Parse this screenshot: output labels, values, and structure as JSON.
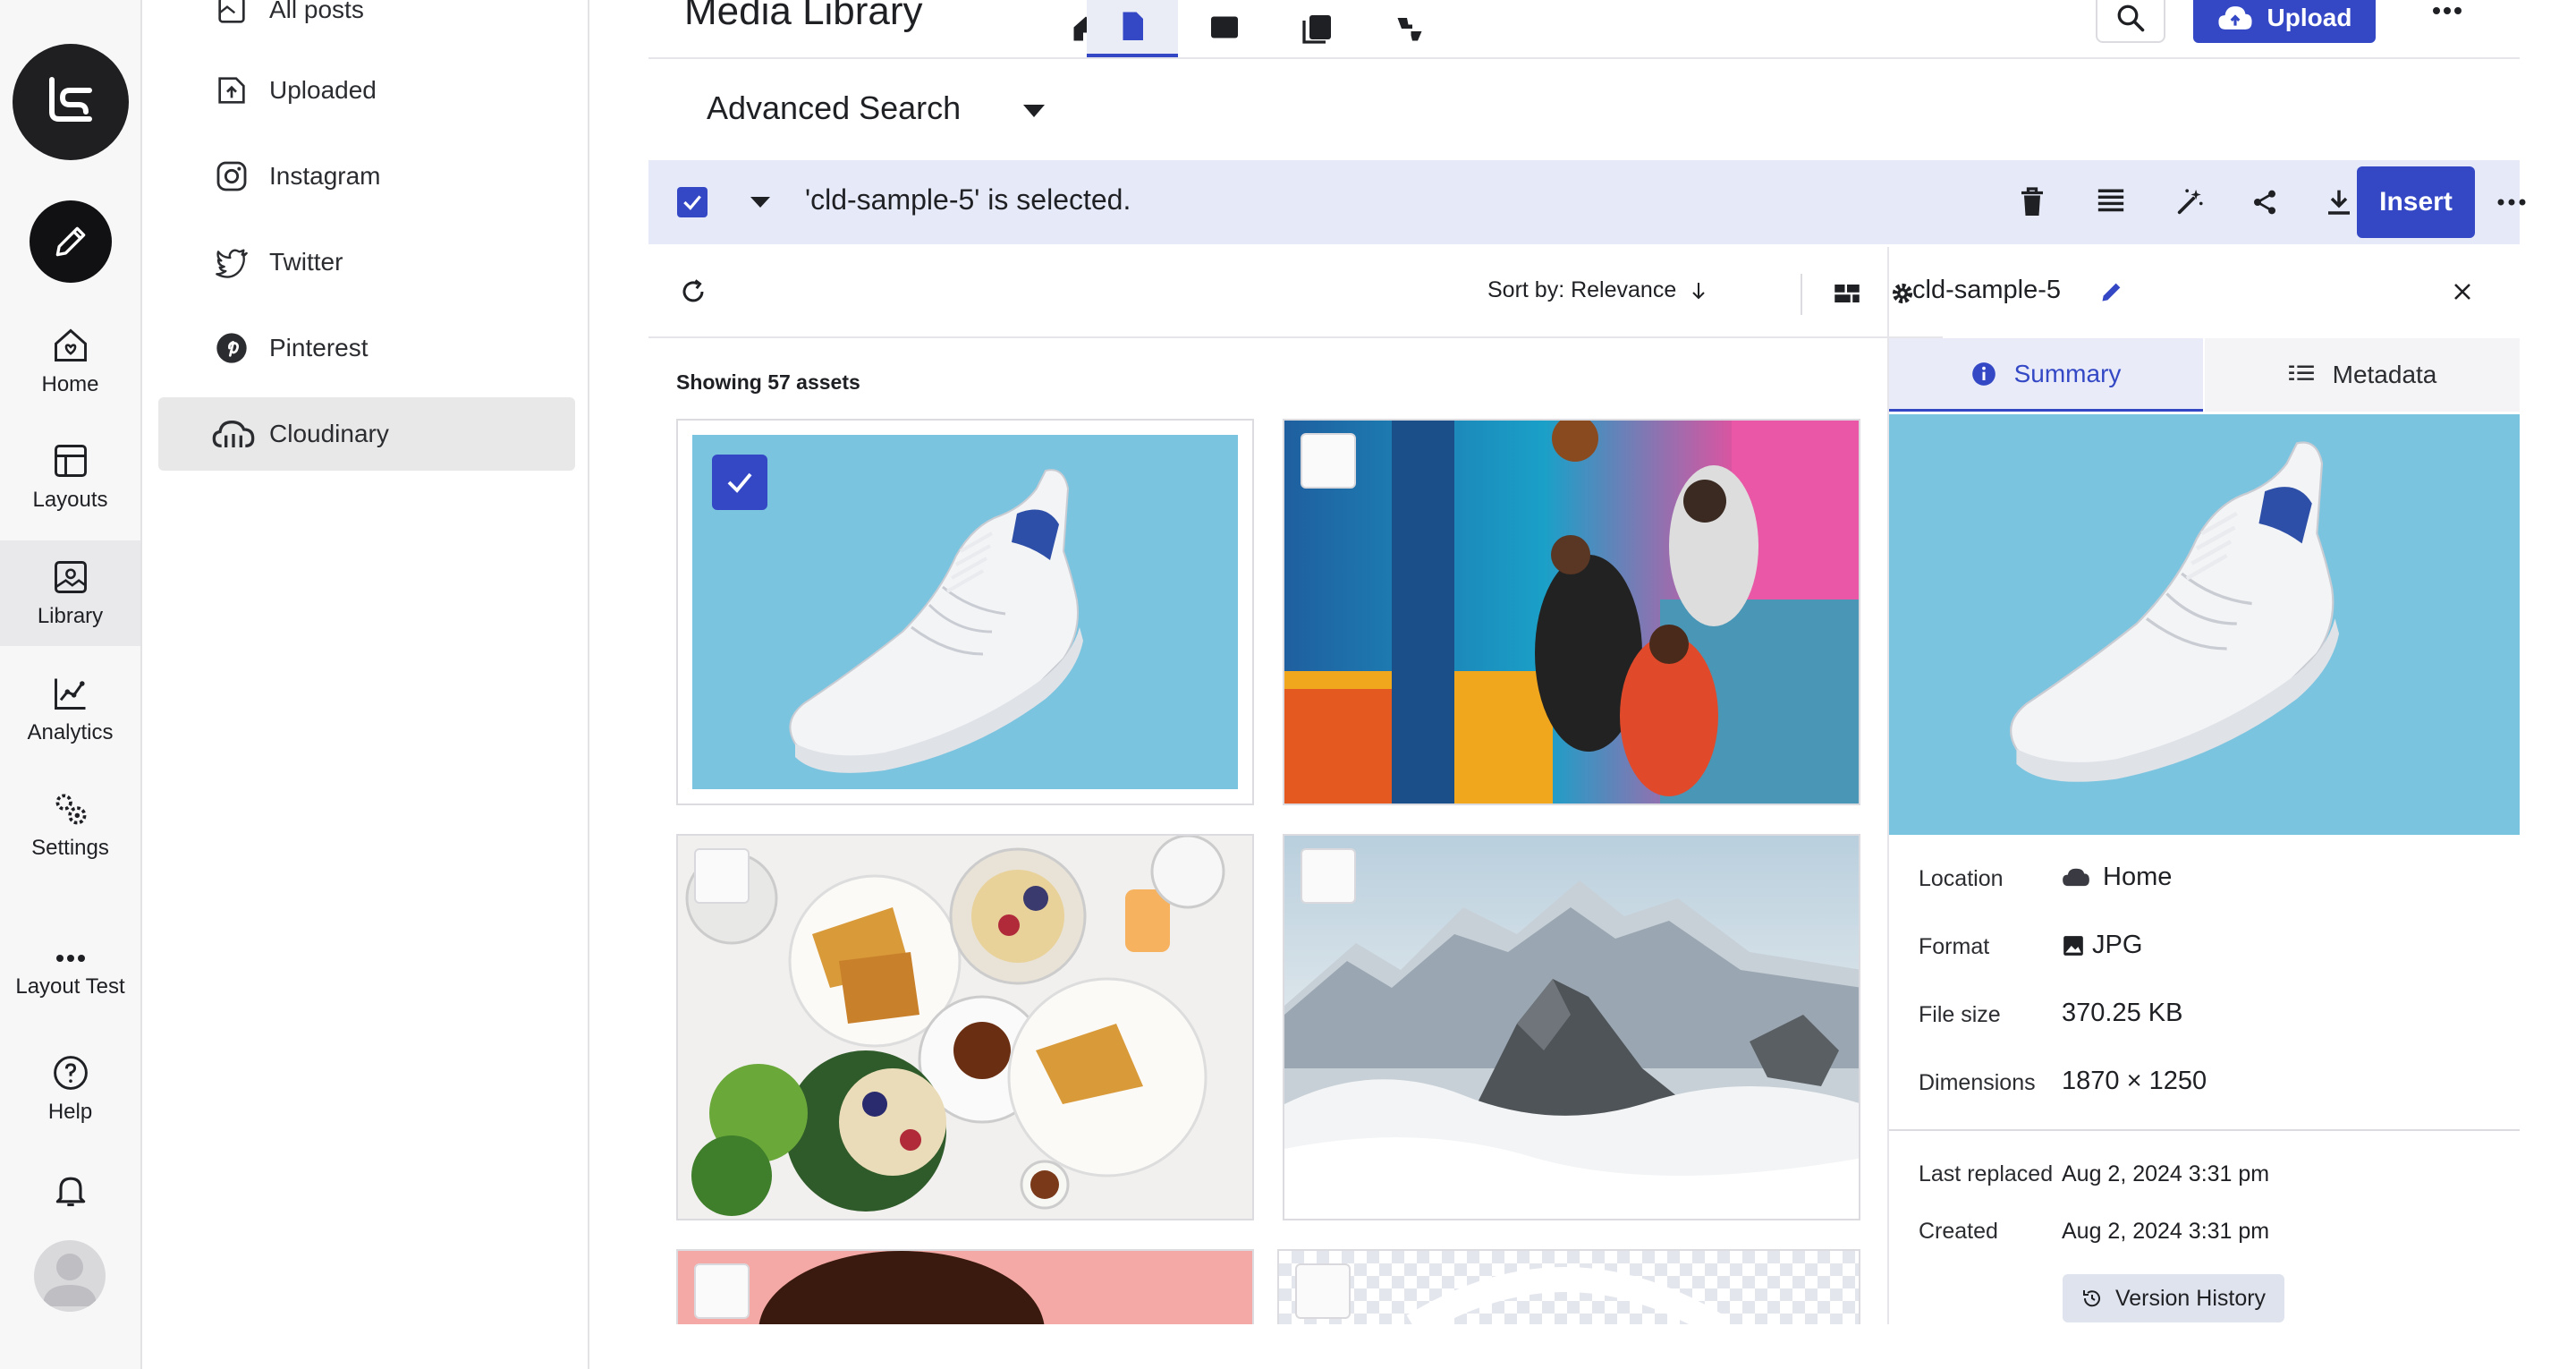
{
  "rail": {
    "items": [
      {
        "label": "Home",
        "icon": "home-heart-icon"
      },
      {
        "label": "Layouts",
        "icon": "layouts-icon"
      },
      {
        "label": "Library",
        "icon": "library-icon"
      },
      {
        "label": "Analytics",
        "icon": "analytics-icon"
      },
      {
        "label": "Settings",
        "icon": "settings-icon"
      },
      {
        "label": "Layout Test",
        "icon": "more-dots-icon"
      },
      {
        "label": "Help",
        "icon": "help-icon"
      }
    ],
    "active": "Library"
  },
  "sources": {
    "items": [
      {
        "label": "All posts",
        "icon": "all-posts-icon"
      },
      {
        "label": "Uploaded",
        "icon": "upload-icon"
      },
      {
        "label": "Instagram",
        "icon": "instagram-icon"
      },
      {
        "label": "Twitter",
        "icon": "twitter-icon"
      },
      {
        "label": "Pinterest",
        "icon": "pinterest-icon"
      },
      {
        "label": "Cloudinary",
        "icon": "cloudinary-icon"
      }
    ],
    "active": "Cloudinary"
  },
  "header": {
    "title": "Media Library",
    "upload_label": "Upload"
  },
  "search": {
    "advanced_label": "Advanced Search"
  },
  "selection": {
    "text": "'cld-sample-5' is selected.",
    "insert_label": "Insert"
  },
  "toolbar": {
    "sort_label": "Sort by: Relevance"
  },
  "grid": {
    "showing": "Showing 57 assets"
  },
  "detail": {
    "name": "cld-sample-5",
    "tabs": [
      "Summary",
      "Metadata"
    ],
    "active_tab": "Summary",
    "rows": [
      {
        "label": "Location",
        "value": "Home"
      },
      {
        "label": "Format",
        "value": "JPG"
      },
      {
        "label": "File size",
        "value": "370.25 KB"
      },
      {
        "label": "Dimensions",
        "value": "1870 × 1250"
      },
      {
        "label": "Last replaced",
        "value": "Aug 2, 2024 3:31 pm"
      },
      {
        "label": "Created",
        "value": "Aug 2, 2024 3:31 pm"
      }
    ],
    "version_history_label": "Version History"
  },
  "colors": {
    "accent": "#3448c5",
    "selection_bar": "#e6e9f7"
  }
}
